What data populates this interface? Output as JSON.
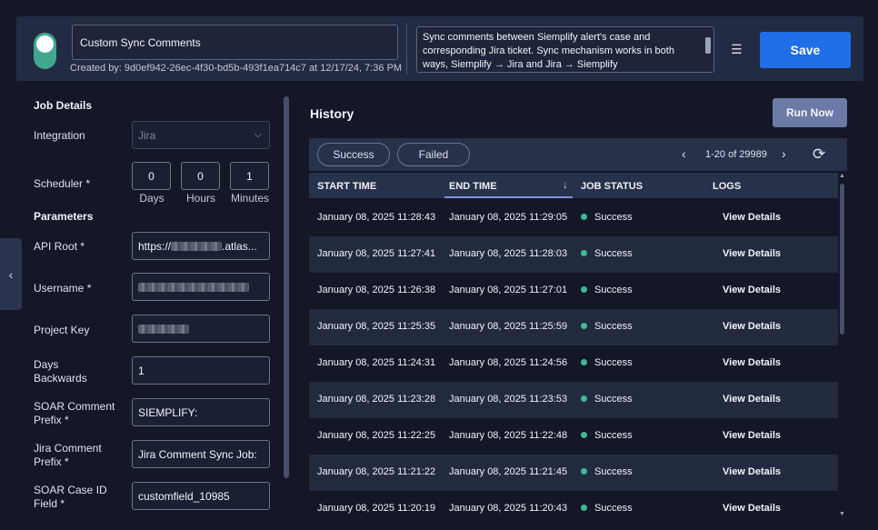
{
  "header": {
    "job_name": "Custom Sync Comments",
    "created_by": "Created by: 9d0ef942-26ec-4f30-bd5b-493f1ea714c7 at 12/17/24, 7:36 PM",
    "description": "Sync comments between Siemplify alert's case and corresponding Jira ticket. Sync mechanism works in both ways, Siemplify → Jira and Jira → Siemplify",
    "save_label": "Save",
    "enabled": true
  },
  "job_details": {
    "section_title": "Job Details",
    "integration_label": "Integration",
    "integration_value": "Jira",
    "scheduler_label": "Scheduler *",
    "days_value": "0",
    "days_label": "Days",
    "hours_value": "0",
    "hours_label": "Hours",
    "minutes_value": "1",
    "minutes_label": "Minutes"
  },
  "parameters": {
    "section_title": "Parameters",
    "api_root_label": "API Root *",
    "api_root_prefix": "https://",
    "api_root_suffix": ".atlas...",
    "username_label": "Username *",
    "project_key_label": "Project Key",
    "days_backwards_label_1": "Days",
    "days_backwards_label_2": "Backwards",
    "days_backwards_value": "1",
    "soar_prefix_label_1": "SOAR Comment",
    "soar_prefix_label_2": "Prefix *",
    "soar_prefix_value": "SIEMPLIFY:",
    "jira_prefix_label_1": "Jira Comment",
    "jira_prefix_label_2": "Prefix *",
    "jira_prefix_value": "Jira Comment Sync Job:",
    "case_id_label_1": "SOAR Case ID",
    "case_id_label_2": "Field *",
    "case_id_value": "customfield_10985"
  },
  "history": {
    "title": "History",
    "run_now_label": "Run Now",
    "filter_success": "Success",
    "filter_failed": "Failed",
    "pagination": "1-20 of 29989",
    "columns": [
      "START TIME",
      "END TIME",
      "JOB STATUS",
      "LOGS"
    ],
    "rows": [
      {
        "start": "January 08, 2025 11:28:43",
        "end": "January 08, 2025 11:29:05",
        "status": "Success",
        "logs": "View Details"
      },
      {
        "start": "January 08, 2025 11:27:41",
        "end": "January 08, 2025 11:28:03",
        "status": "Success",
        "logs": "View Details"
      },
      {
        "start": "January 08, 2025 11:26:38",
        "end": "January 08, 2025 11:27:01",
        "status": "Success",
        "logs": "View Details"
      },
      {
        "start": "January 08, 2025 11:25:35",
        "end": "January 08, 2025 11:25:59",
        "status": "Success",
        "logs": "View Details"
      },
      {
        "start": "January 08, 2025 11:24:31",
        "end": "January 08, 2025 11:24:56",
        "status": "Success",
        "logs": "View Details"
      },
      {
        "start": "January 08, 2025 11:23:28",
        "end": "January 08, 2025 11:23:53",
        "status": "Success",
        "logs": "View Details"
      },
      {
        "start": "January 08, 2025 11:22:25",
        "end": "January 08, 2025 11:22:48",
        "status": "Success",
        "logs": "View Details"
      },
      {
        "start": "January 08, 2025 11:21:22",
        "end": "January 08, 2025 11:21:45",
        "status": "Success",
        "logs": "View Details"
      },
      {
        "start": "January 08, 2025 11:20:19",
        "end": "January 08, 2025 11:20:43",
        "status": "Success",
        "logs": "View Details"
      }
    ]
  },
  "icons": {
    "list": "list-icon",
    "collapse": "chevron-left-icon",
    "refresh": "refresh-icon"
  },
  "colors": {
    "accent": "#1e6fe8",
    "success": "#3fb994",
    "toggle_on": "#3fa88d",
    "background": "#131726",
    "panel": "#232b42"
  }
}
